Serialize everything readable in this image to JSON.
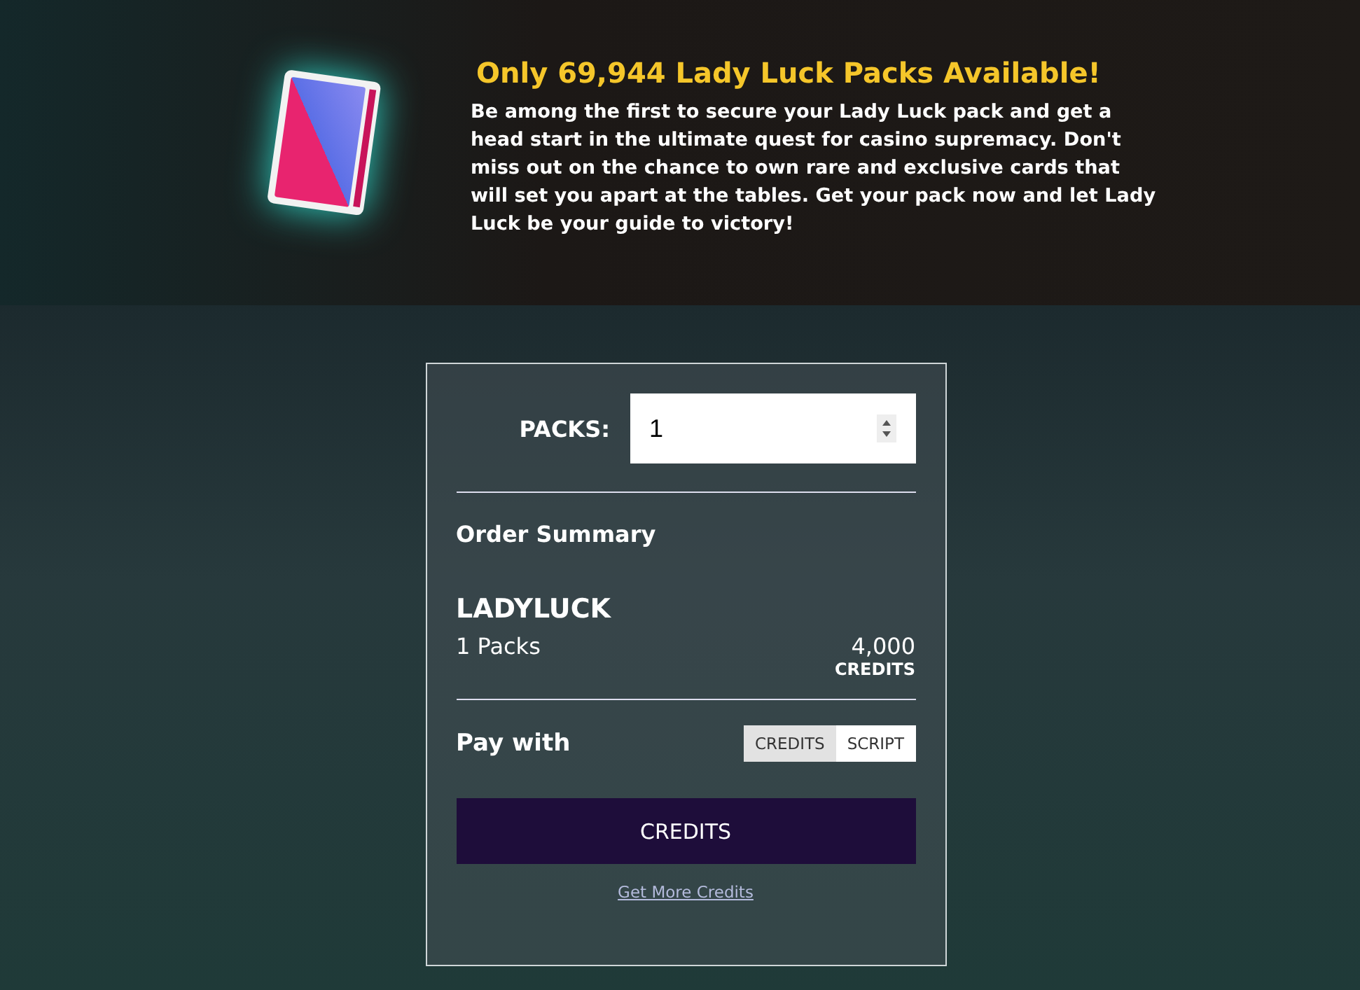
{
  "banner": {
    "title": "Only 69,944  Lady Luck Packs Available!",
    "description": "Be among the first to secure your Lady Luck pack and get a head start in the ultimate quest for casino supremacy. Don't miss out on the chance to own rare and exclusive cards that will set you apart at the tables. Get your pack now and let Lady Luck be your guide to victory!"
  },
  "order_form": {
    "packs_label": "PACKS:",
    "packs_value": "1",
    "summary_title": "Order Summary",
    "product_name": "LADYLUCK",
    "quantity": "1 Packs",
    "price": "4,000",
    "price_unit": "CREDITS",
    "pay_with_label": "Pay with",
    "payment_options": [
      {
        "label": "CREDITS",
        "selected": true
      },
      {
        "label": "SCRIPT",
        "selected": false
      }
    ],
    "submit_button": "CREDITS",
    "link": "Get More Credits"
  }
}
